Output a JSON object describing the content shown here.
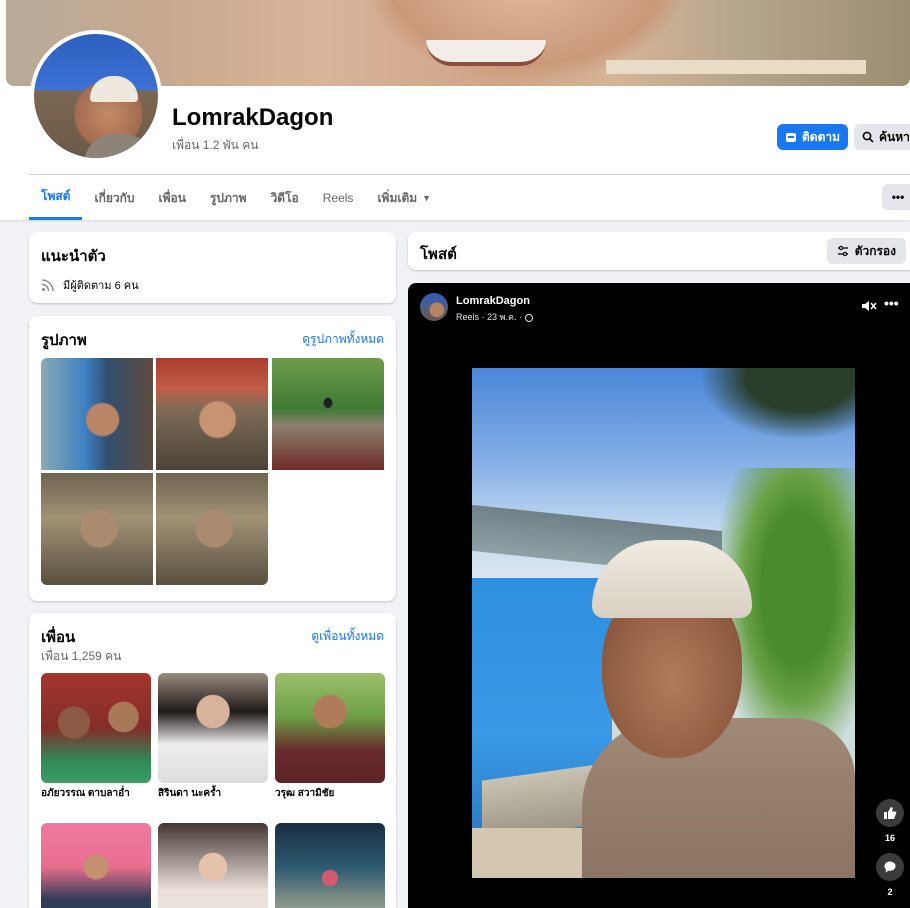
{
  "profile": {
    "name": "LomrakDagon",
    "friends_count": "เพื่อน 1.2 พัน คน",
    "follow_label": "ติดตาม",
    "search_label": "ค้นหา"
  },
  "tabs": [
    {
      "label": "โพสต์",
      "active": true
    },
    {
      "label": "เกี่ยวกับ"
    },
    {
      "label": "เพื่อน"
    },
    {
      "label": "รูปภาพ"
    },
    {
      "label": "วิดีโอ"
    },
    {
      "label": "Reels"
    },
    {
      "label": "เพิ่มเติม"
    }
  ],
  "intro": {
    "title": "แนะนำตัว",
    "followers": "มีผู้ติดตาม 6 คน"
  },
  "photos": {
    "title": "รูปภาพ",
    "see_all": "ดูรูปภาพทั้งหมด"
  },
  "friends": {
    "title": "เพื่อน",
    "count": "เพื่อน 1,259 คน",
    "see_all": "ดูเพื่อนทั้งหมด",
    "items": [
      {
        "name": "อภัยวรรณ ตาบลาอ่ำ"
      },
      {
        "name": "สิรินดา นะคร้ำ"
      },
      {
        "name": "วรุฒ สวามิชัย"
      },
      {
        "name": ""
      },
      {
        "name": ""
      },
      {
        "name": ""
      }
    ]
  },
  "posts": {
    "title": "โพสต์",
    "filter_label": "ตัวกรอง"
  },
  "reel": {
    "author": "LomrakDagon",
    "meta": "Reels · 23 พ.ค. ·",
    "likes": "16",
    "comments": "2"
  },
  "colors": {
    "accent": "#1877f2",
    "page_bg": "#f0f2f5"
  }
}
